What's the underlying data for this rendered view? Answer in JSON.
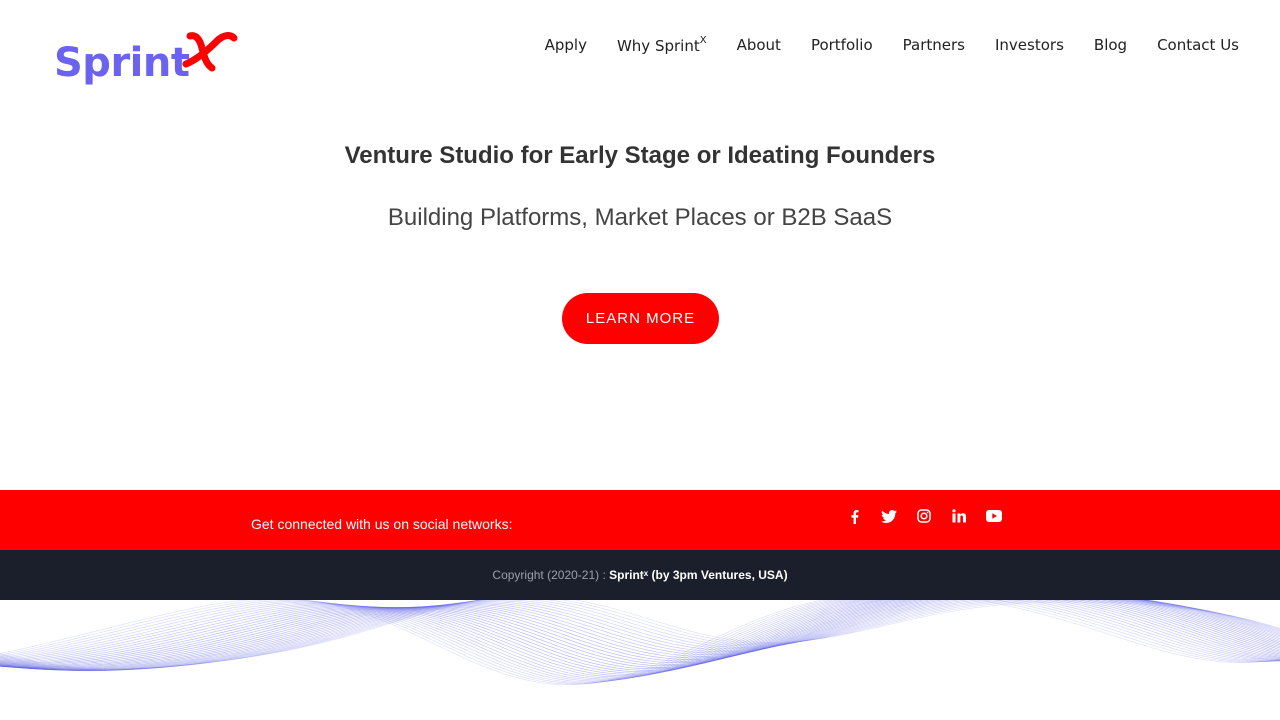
{
  "brand": {
    "logo_word": "Sprint",
    "logo_mark": "x",
    "primary_color": "#6b63f0",
    "accent_color": "#ff0000"
  },
  "nav": {
    "items": [
      {
        "label": "Apply"
      },
      {
        "label": "Why Sprint",
        "sup": "X"
      },
      {
        "label": "About"
      },
      {
        "label": "Portfolio"
      },
      {
        "label": "Partners"
      },
      {
        "label": "Investors"
      },
      {
        "label": "Blog"
      },
      {
        "label": "Contact Us"
      }
    ]
  },
  "hero": {
    "title": "Venture Studio for Early Stage or Ideating Founders",
    "subtitle": "Building Platforms, Market Places or B2B SaaS",
    "cta_label": "LEARN MORE"
  },
  "social": {
    "text": "Get connected with us on social networks:",
    "icons": [
      "facebook-icon",
      "twitter-icon",
      "instagram-icon",
      "linkedin-icon",
      "youtube-icon"
    ]
  },
  "footer": {
    "copyright_prefix": "Copyright (2020-21) : ",
    "copyright_owner": "Sprintˣ (by 3pm Ventures, USA)",
    "band_color": "#1b1f2b"
  }
}
